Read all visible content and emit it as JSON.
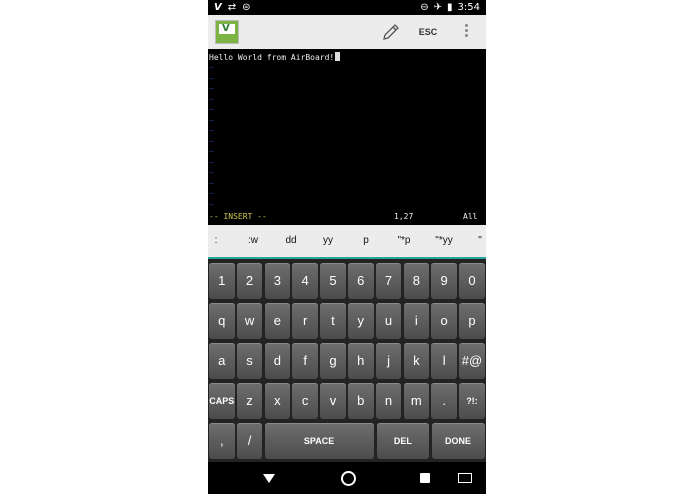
{
  "status_bar": {
    "left_icons": [
      "vim-v-icon",
      "wifi-off-icon",
      "robot-icon"
    ],
    "time": "3:54",
    "right_icons": [
      "do-not-disturb-icon",
      "airplane-icon",
      "battery-icon"
    ]
  },
  "app_bar": {
    "esc_label": "ESC",
    "logo_letter": "V",
    "icons": [
      "app-logo-icon",
      "pencil-icon",
      "more-vert-icon"
    ]
  },
  "editor": {
    "text": "Hello World from AirBoard!",
    "mode": "-- INSERT --",
    "position": "1,27",
    "scroll": "All"
  },
  "shortcuts": [
    ":",
    ":w",
    "dd",
    "yy",
    "p",
    "\"*p",
    "\"*yy",
    "\""
  ],
  "keyboard": {
    "row1": [
      "1",
      "2",
      "3",
      "4",
      "5",
      "6",
      "7",
      "8",
      "9",
      "0"
    ],
    "row2": [
      "q",
      "w",
      "e",
      "r",
      "t",
      "y",
      "u",
      "i",
      "o",
      "p"
    ],
    "row3": [
      "a",
      "s",
      "d",
      "f",
      "g",
      "h",
      "j",
      "k",
      "l",
      "#@"
    ],
    "row4": [
      "CAPS",
      "z",
      "x",
      "c",
      "v",
      "b",
      "n",
      "m",
      ".",
      "?!:"
    ],
    "row5": [
      ",",
      "/",
      "SPACE",
      "DEL",
      "DONE"
    ]
  },
  "nav_bar": {
    "icons": [
      "back-icon",
      "home-icon",
      "recents-icon",
      "keyboard-icon"
    ]
  }
}
